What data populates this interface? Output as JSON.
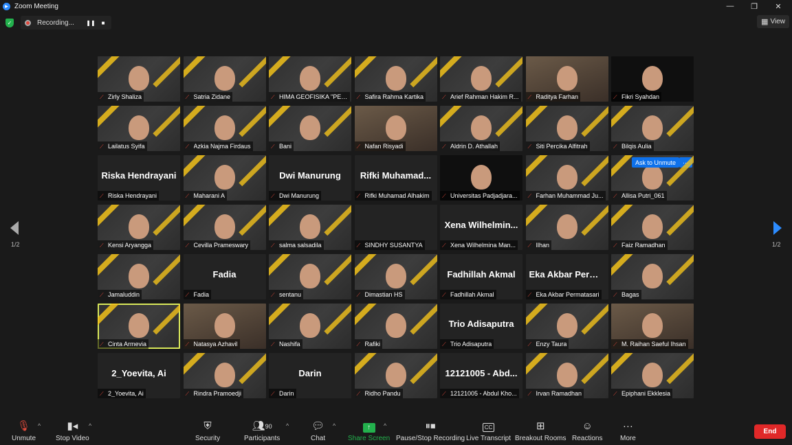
{
  "window": {
    "title": "Zoom Meeting",
    "minimize": "—",
    "restore": "❐",
    "close": "✕"
  },
  "recording": {
    "status": "Recording...",
    "pause_icon": "pause-icon",
    "stop_icon": "stop-icon"
  },
  "view_button": {
    "label": "View"
  },
  "pager": {
    "left": "1/2",
    "right": "1/2"
  },
  "participants": [
    {
      "name": "Zirly Shaliza",
      "kind": "poster"
    },
    {
      "name": "Satria Zidane",
      "kind": "poster"
    },
    {
      "name": "HIMA GEOFISIKA \"PED...",
      "kind": "poster"
    },
    {
      "name": "Safira Rahma Kartika",
      "kind": "poster"
    },
    {
      "name": "Arief Rahman Hakim R...",
      "kind": "poster"
    },
    {
      "name": "Raditya Farhan",
      "kind": "photo"
    },
    {
      "name": "Fikri Syahdan",
      "kind": "dark"
    },
    {
      "name": "Lailatus Syifa",
      "kind": "poster"
    },
    {
      "name": "Azkia Najma Firdaus",
      "kind": "poster"
    },
    {
      "name": "Bani",
      "kind": "poster"
    },
    {
      "name": "Nafan Risyadi",
      "kind": "photo"
    },
    {
      "name": "Aldrin D. Athallah",
      "kind": "poster"
    },
    {
      "name": "Siti Percika Alfitrah",
      "kind": "poster"
    },
    {
      "name": "Bilqis Aulia",
      "kind": "poster"
    },
    {
      "name": "Riska Hendrayani",
      "kind": "name",
      "big": "Riska Hendrayani"
    },
    {
      "name": "Maharani A",
      "kind": "poster"
    },
    {
      "name": "Dwi Manurung",
      "kind": "name",
      "big": "Dwi Manurung"
    },
    {
      "name": "Rifki Muhamad Alhakim",
      "kind": "name",
      "big": "Rifki  Muhamad..."
    },
    {
      "name": "Universitas Padjadjara...",
      "kind": "dark"
    },
    {
      "name": "Farhan Muhammad Ju...",
      "kind": "poster"
    },
    {
      "name": "Allisa Putri_061",
      "kind": "poster",
      "ask": "Ask to Unmute",
      "more": "···"
    },
    {
      "name": "Kensi Aryangga",
      "kind": "poster"
    },
    {
      "name": "Cevilla Prameswary",
      "kind": "poster"
    },
    {
      "name": "salma salsadila",
      "kind": "poster"
    },
    {
      "name": "SINDHY SUSANTYA",
      "kind": "blank"
    },
    {
      "name": "Xena Wilhelmina Man...",
      "kind": "name",
      "big": "Xena  Wilhelmin..."
    },
    {
      "name": "Ilhan",
      "kind": "poster"
    },
    {
      "name": "Faiz Ramadhan",
      "kind": "poster"
    },
    {
      "name": "Jamaluddin",
      "kind": "poster"
    },
    {
      "name": "Fadia",
      "kind": "name",
      "big": "Fadia"
    },
    {
      "name": "sentanu",
      "kind": "poster"
    },
    {
      "name": "Dimastian HS",
      "kind": "poster"
    },
    {
      "name": "Fadhillah Akmal",
      "kind": "name",
      "big": "Fadhillah Akmal"
    },
    {
      "name": "Eka Akbar Permatasari",
      "kind": "name",
      "big": "Eka  Akbar  Perm..."
    },
    {
      "name": "Bagas",
      "kind": "poster"
    },
    {
      "name": "Cinta Armevia",
      "kind": "poster",
      "active": true
    },
    {
      "name": "Natasya Azhavil",
      "kind": "photo"
    },
    {
      "name": "Nashifa",
      "kind": "poster"
    },
    {
      "name": "Rafiki",
      "kind": "poster"
    },
    {
      "name": "Trio Adisaputra",
      "kind": "name",
      "big": "Trio Adisaputra"
    },
    {
      "name": "Enzy Taura",
      "kind": "poster"
    },
    {
      "name": "M. Raihan Saeful Ihsan",
      "kind": "photo"
    },
    {
      "name": "2_Yoevita, Ai",
      "kind": "name",
      "big": "2_Yoevita, Ai"
    },
    {
      "name": "Rindra Pramoedji",
      "kind": "poster"
    },
    {
      "name": "Darin",
      "kind": "name",
      "big": "Darin"
    },
    {
      "name": "Ridho Pandu",
      "kind": "poster"
    },
    {
      "name": "12121005 - Abdul Kho...",
      "kind": "name",
      "big": "12121005  -  Abd..."
    },
    {
      "name": "Irvan Ramadhan",
      "kind": "poster"
    },
    {
      "name": "Epiphani Ekklesia",
      "kind": "poster"
    }
  ],
  "toolbar": {
    "unmute": "Unmute",
    "stop_video": "Stop Video",
    "security": "Security",
    "participants": "Participants",
    "participants_count": "90",
    "chat": "Chat",
    "share_screen": "Share Screen",
    "pause_stop_recording": "Pause/Stop Recording",
    "live_transcript": "Live Transcript",
    "breakout_rooms": "Breakout Rooms",
    "reactions": "Reactions",
    "more": "More",
    "end": "End"
  },
  "colors": {
    "accent_blue": "#0e71eb",
    "end_red": "#e02828",
    "share_green": "#23b14d",
    "speaker_outline": "#d9e85a",
    "poster_yellow": "#f2c21b"
  }
}
